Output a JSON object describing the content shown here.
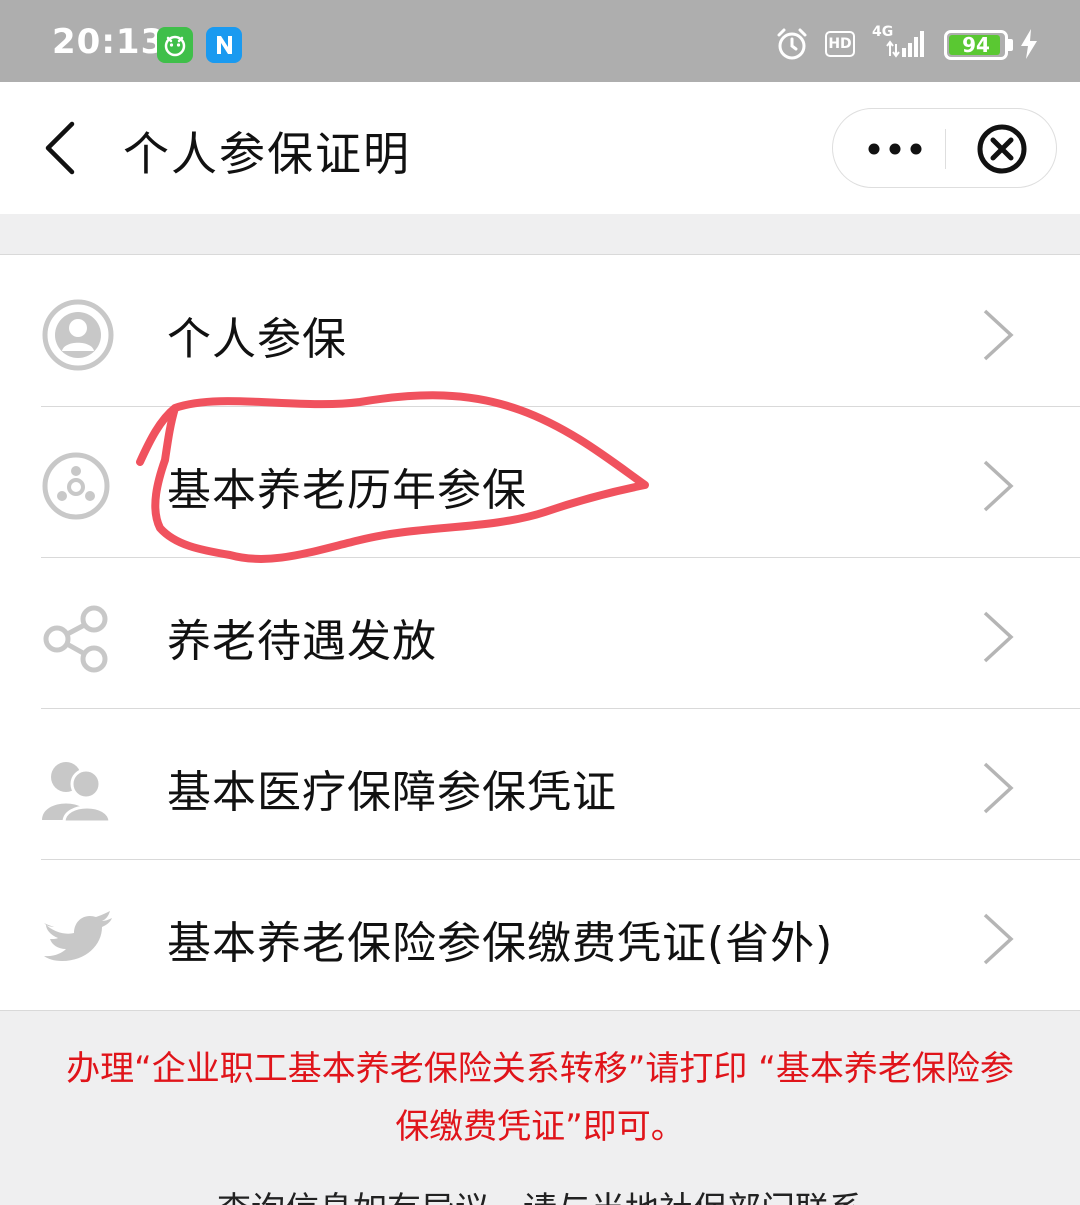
{
  "status_bar": {
    "time": "20:13",
    "hd_label": "HD",
    "network_label": "4G",
    "battery_level": "94",
    "battery_fraction": 0.94
  },
  "nav": {
    "title": "个人参保证明",
    "icons": [
      "back-icon",
      "more-icon",
      "close-icon"
    ]
  },
  "list": {
    "items": [
      {
        "label": "个人参保",
        "icon": "person-circle-icon"
      },
      {
        "label": "基本养老历年参保",
        "icon": "dots-circle-icon"
      },
      {
        "label": "养老待遇发放",
        "icon": "share-icon"
      },
      {
        "label": "基本医疗保障参保凭证",
        "icon": "people-icon"
      },
      {
        "label": "基本养老保险参保缴费凭证(省外)",
        "icon": "bird-icon"
      }
    ]
  },
  "notice": {
    "text": "办理“企业职工基本养老保险关系转移”请打印 “基本养老保险参保缴费凭证”即可。"
  },
  "footer": {
    "text": "查询信息如有异议，请与当地社保部门联系"
  },
  "colors": {
    "status_bar_bg": "#aeaeae",
    "notice_red": "#e0141a",
    "annotation_red": "#f0525e",
    "icon_gray": "#c8c8c8",
    "battery_green": "#5ac832"
  }
}
